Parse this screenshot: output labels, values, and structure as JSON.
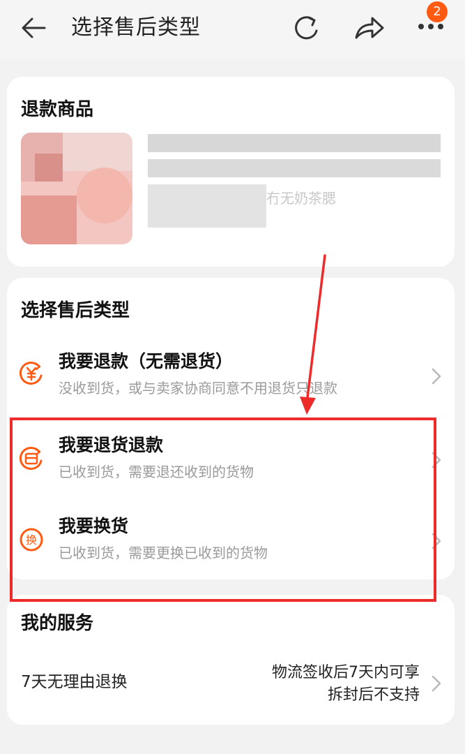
{
  "header": {
    "title": "选择售后类型",
    "badge_count": "2",
    "icons": [
      "back-arrow-icon",
      "refresh-icon",
      "share-icon",
      "more-icon"
    ]
  },
  "refund_item": {
    "title": "退款商品",
    "product_name_partial": "冇无奶茶腮"
  },
  "aftersale": {
    "title": "选择售后类型",
    "options": [
      {
        "title": "我要退款（无需退货）",
        "desc": "没收到货，或与卖家协商同意不用退货只退款",
        "icon": "yen-refund-icon"
      },
      {
        "title": "我要退货退款",
        "desc": "已收到货，需要退还收到的货物",
        "icon": "return-box-icon"
      },
      {
        "title": "我要换货",
        "desc": "已收到货，需要更换已收到的货物",
        "icon": "exchange-icon"
      }
    ]
  },
  "services": {
    "title": "我的服务",
    "item_label": "7天无理由退换",
    "note_line1": "物流签收后7天内可享",
    "note_line2": "拆封后不支持"
  },
  "colors": {
    "accent": "#ff5a12",
    "annotation": "#ee2b2b"
  }
}
